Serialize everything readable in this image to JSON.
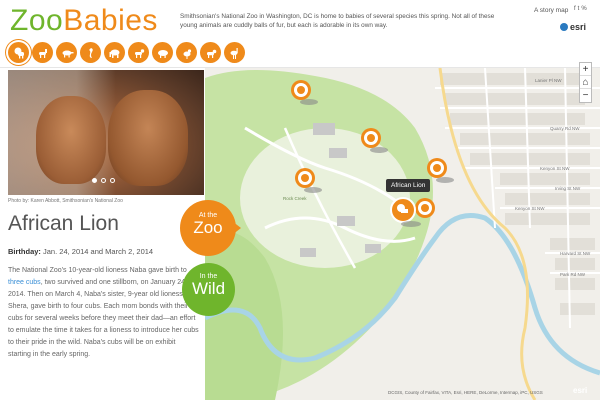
{
  "app": {
    "logo_part1": "Zoo",
    "logo_part2": "Babies",
    "blurb": "Smithsonian's National Zoo in Washington, DC is home to babies of several species this spring. Not all of these young animals are cuddly balls of fur, but each is adorable in its own way.",
    "story_link": "A story map",
    "share_icons": [
      "f",
      "t",
      "%"
    ],
    "esri": "esri"
  },
  "tabs": [
    {
      "name": "tab-lion",
      "icon": "lion-icon",
      "active": true
    },
    {
      "name": "tab-deer",
      "icon": "deer-icon"
    },
    {
      "name": "tab-anteater",
      "icon": "anteater-icon"
    },
    {
      "name": "tab-seahorse",
      "icon": "seahorse-icon"
    },
    {
      "name": "tab-elephant",
      "icon": "elephant-icon"
    },
    {
      "name": "tab-goat",
      "icon": "goat-icon"
    },
    {
      "name": "tab-boar",
      "icon": "boar-icon"
    },
    {
      "name": "tab-bird",
      "icon": "bird-icon"
    },
    {
      "name": "tab-cat",
      "icon": "cat-icon"
    },
    {
      "name": "tab-ostrich",
      "icon": "ostrich-icon"
    }
  ],
  "photo": {
    "caption": "Photo by: Karen Abbott, Smithsonian's National Zoo",
    "slides": 3,
    "active_slide": 1
  },
  "species": {
    "title": "African Lion",
    "birthday_label": "Birthday:",
    "birthday_value": "Jan. 24, 2014 and March 2, 2014",
    "desc_1": "The National Zoo's 10-year-old lioness Naba gave birth to ",
    "desc_link": "three cubs",
    "desc_2": ", two survived and one stillborn, on January 24, 2014. Then on March 4, Naba's sister, 9-year old lioness, Shera, gave birth to four cubs. Each mom bonds with their cubs for several weeks before they meet their dad—an effort to emulate the time it takes for a lioness to introduce her cubs to their pride in the wild. Naba's cubs will be on exhibit starting in the early spring."
  },
  "toggles": {
    "zoo_small": "At the",
    "zoo_large": "Zoo",
    "wild_small": "In the",
    "wild_large": "Wild"
  },
  "map": {
    "zoom_in": "+",
    "home": "⌂",
    "zoom_out": "−",
    "popup": "African Lion",
    "attribution": "DCGIS, County of Fairfax, VITA, Esri, HERE, DeLorme, Intermap, iPC, USGS",
    "esri_small": "esri",
    "street_labels": [
      "Lanier Pl NW",
      "Quarry Rd NW",
      "Kenyon St NW",
      "Irving St NW",
      "Harvard St NW",
      "Park Rd NW",
      "Kenyon St NW",
      "Rock Creek"
    ]
  },
  "colors": {
    "orange": "#ef8a1a",
    "green": "#6fb52c",
    "map_bg": "#f1efea",
    "park": "#c6e3a4",
    "water": "#a8d4e6"
  }
}
